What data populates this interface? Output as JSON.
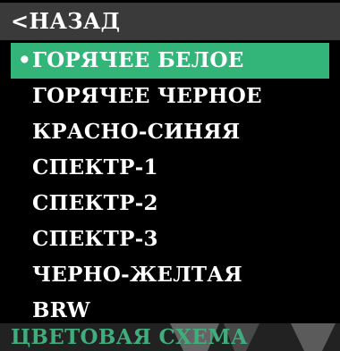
{
  "menu": {
    "back_label": "<НАЗАД",
    "items": [
      {
        "label": "ГОРЯЧЕЕ БЕЛОЕ",
        "selected": true
      },
      {
        "label": "ГОРЯЧЕЕ ЧЕРНОЕ",
        "selected": false
      },
      {
        "label": "КРАСНО-СИНЯЯ",
        "selected": false
      },
      {
        "label": "СПЕКТР-1",
        "selected": false
      },
      {
        "label": "СПЕКТР-2",
        "selected": false
      },
      {
        "label": "СПЕКТР-3",
        "selected": false
      },
      {
        "label": "ЧЕРНО-ЖЕЛТАЯ",
        "selected": false
      },
      {
        "label": "BRW",
        "selected": false
      }
    ],
    "selected_marker": "•"
  },
  "footer": {
    "title": "ЦВЕТОВАЯ СХЕМА"
  },
  "colors": {
    "background": "#000000",
    "back_bar": "#3a3a3a",
    "selection": "#33b57a",
    "footer_text": "#3fae7c",
    "text": "#ffffff"
  }
}
